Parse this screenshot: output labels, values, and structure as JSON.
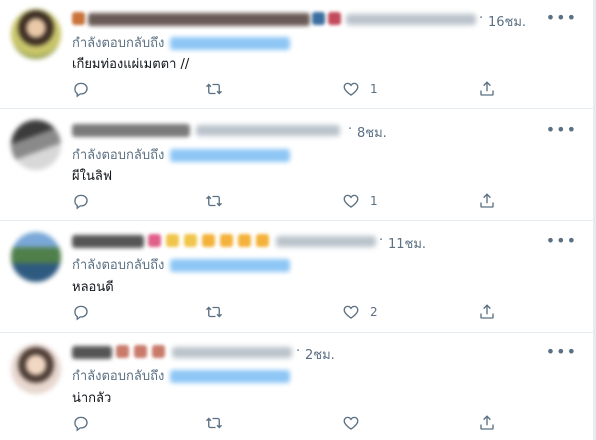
{
  "reply_prefix": "กำลังตอบกลับถึง",
  "tweets": [
    {
      "time": "16ชม.",
      "text": "เกียมท่องแผ่เมตตา //",
      "likes": "1"
    },
    {
      "time": "8ชม.",
      "text": "ผีในลิฟ",
      "likes": "1"
    },
    {
      "time": "11ชม.",
      "text": "หลอนดี",
      "likes": "2"
    },
    {
      "time": "2ชม.",
      "text": "น่ากลัว",
      "likes": ""
    }
  ],
  "icons": {
    "reply": "comment-icon",
    "retweet": "retweet-icon",
    "like": "heart-icon",
    "share": "share-icon",
    "more": "more-icon"
  },
  "colors": {
    "secondary_text": "#5b7083",
    "divider": "#e6ecf0",
    "mention": "#1da1f2"
  }
}
